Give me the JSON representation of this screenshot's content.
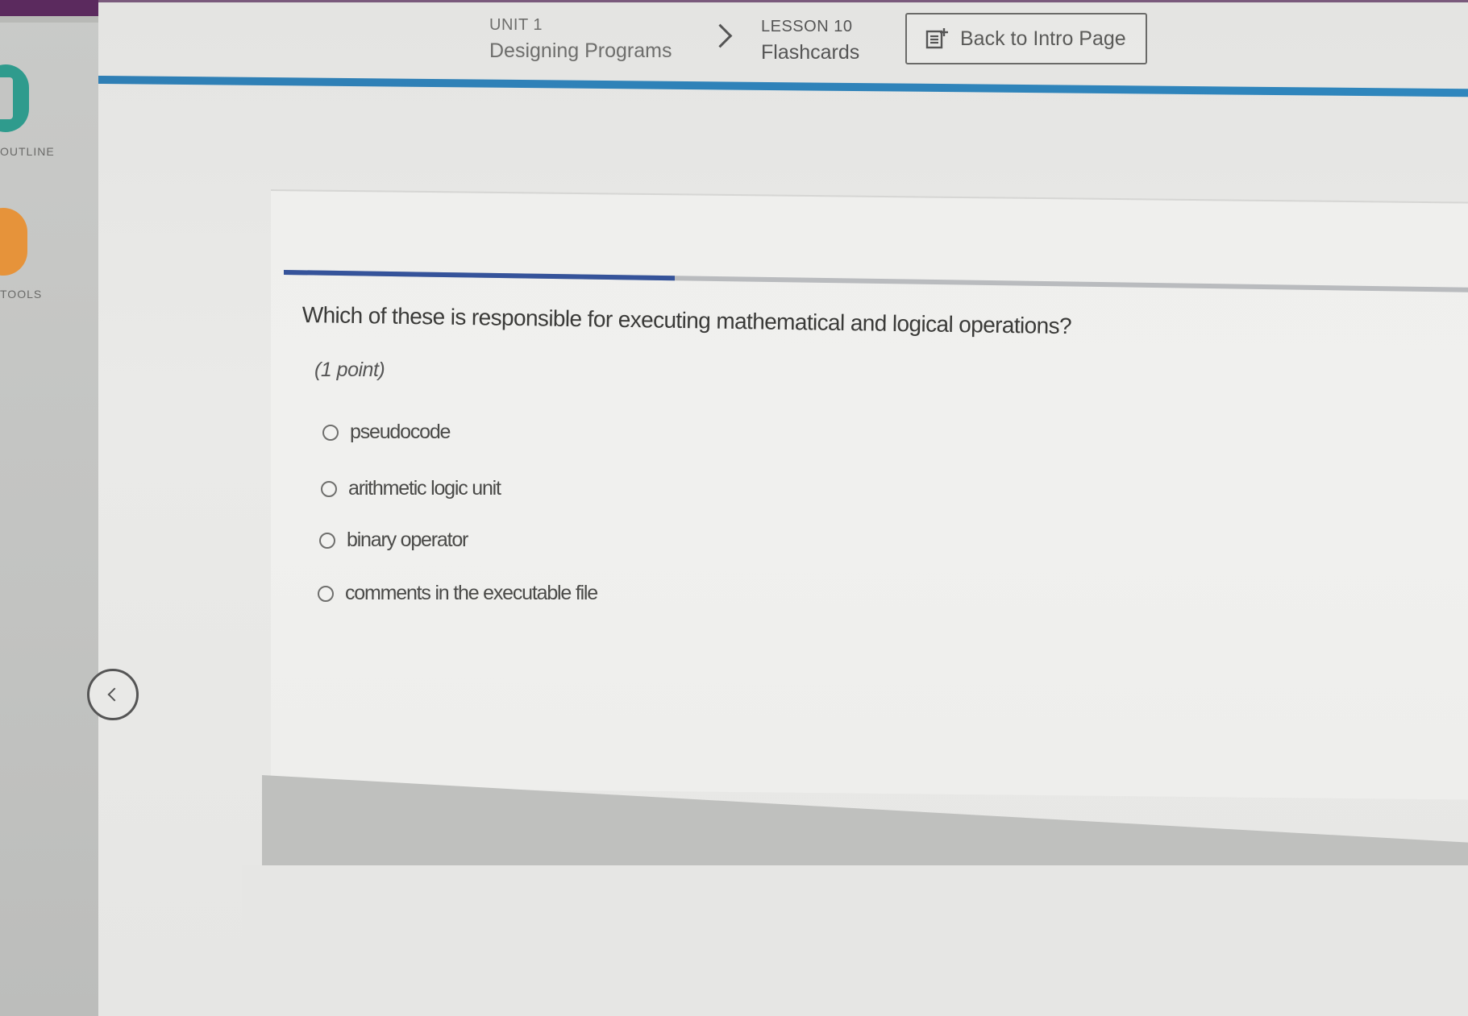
{
  "sidebar": {
    "items": [
      {
        "label": "OUTLINE",
        "icon": "outline-icon",
        "color": "#2f9b8d"
      },
      {
        "label": "TOOLS",
        "icon": "tools-icon",
        "color": "#e6933a"
      }
    ]
  },
  "breadcrumb": {
    "unit_label": "UNIT 1",
    "unit_title": "Designing Programs",
    "lesson_label": "LESSON 10",
    "lesson_title": "Flashcards"
  },
  "header": {
    "back_button_label": "Back to Intro Page",
    "back_button_icon": "intro-page-icon"
  },
  "quiz": {
    "progress_fraction": 0.33,
    "question": "Which of these is responsible for executing mathematical and logical operations?",
    "points": "(1 point)",
    "options": [
      {
        "label": "pseudocode",
        "selected": false
      },
      {
        "label": "arithmetic logic unit",
        "selected": false
      },
      {
        "label": "binary operator",
        "selected": false
      },
      {
        "label": "comments in the executable file",
        "selected": false
      }
    ],
    "prev_icon": "chevron-left-icon"
  },
  "colors": {
    "accent_blue": "#2f7fb5",
    "progress_fill": "#35539a",
    "brand_purple": "#5b2a5e"
  }
}
